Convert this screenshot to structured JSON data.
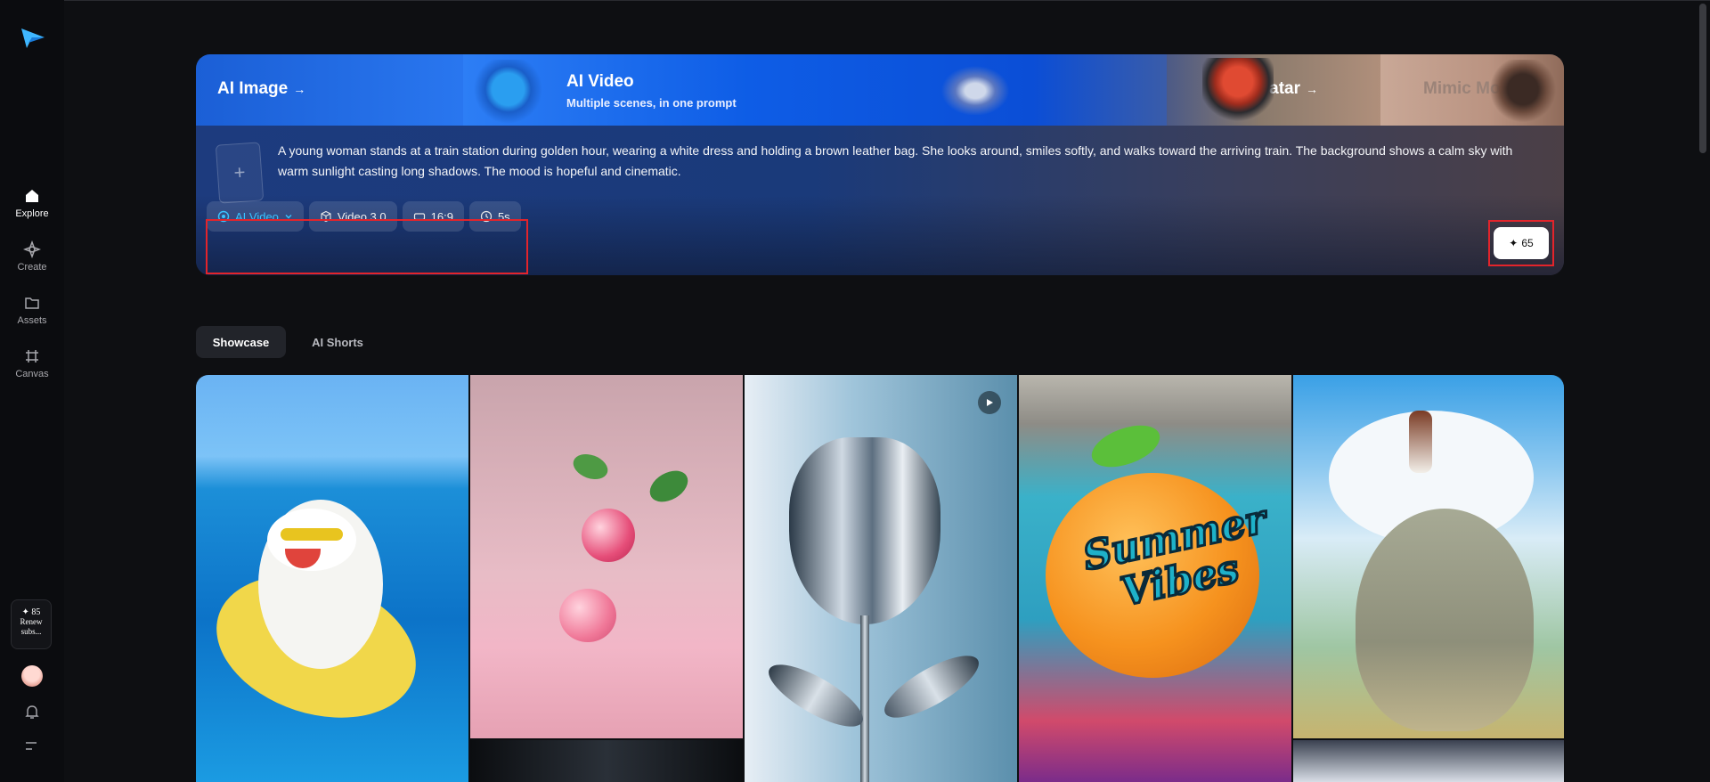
{
  "sidebar": {
    "items": [
      {
        "label": "Explore",
        "icon": "home-icon",
        "active": true
      },
      {
        "label": "Create",
        "icon": "sparkle-diamond-icon",
        "active": false
      },
      {
        "label": "Assets",
        "icon": "folder-icon",
        "active": false
      },
      {
        "label": "Canvas",
        "icon": "canvas-frame-icon",
        "active": false
      }
    ],
    "credits": {
      "amount": "✦ 85",
      "label": "Renew subs..."
    }
  },
  "hero": {
    "tabs": [
      {
        "label": "AI Image",
        "arrow": "→"
      },
      {
        "label": "AI Video",
        "subtitle": "Multiple scenes, in one prompt"
      },
      {
        "label": "AI Avatar",
        "arrow": "→"
      },
      {
        "label": "Mimic Motion",
        "arrow": "→"
      }
    ],
    "upload_placeholder": "+",
    "prompt": "A young woman stands at a train station during golden hour, wearing a white dress and holding a brown leather bag. She looks around, smiles softly, and walks toward the arriving train. The background shows a calm sky with warm sunlight casting long shadows. The mood is hopeful and cinematic.",
    "controls": {
      "mode": "AI Video",
      "model": "Video 3.0",
      "ratio": "16:9",
      "duration": "5s"
    },
    "generate": {
      "icon": "✦",
      "cost": "65"
    }
  },
  "showcase_tabs": [
    {
      "label": "Showcase",
      "active": true
    },
    {
      "label": "AI Shorts",
      "active": false
    }
  ],
  "gallery": {
    "summer_text": "Summer Vibes"
  },
  "colors": {
    "background": "#0e0f12",
    "accent": "#39c3ff",
    "highlight_border": "#e3242b"
  }
}
